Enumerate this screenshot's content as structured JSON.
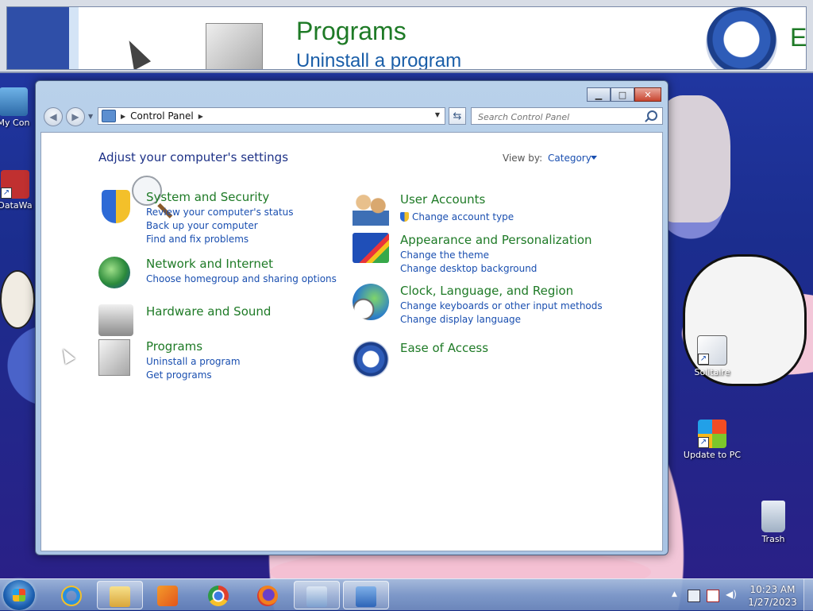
{
  "magnifier": {
    "title": "Programs",
    "subtitle": "Uninstall a program",
    "right_fragment": "E"
  },
  "desktop": {
    "icons": [
      {
        "name": "My Con",
        "icon": "computer-icon"
      },
      {
        "name": "DataWa",
        "icon": "app-shortcut-icon"
      },
      {
        "name": "Solitaire",
        "icon": "solitaire-icon"
      },
      {
        "name": "Update to PC",
        "icon": "windows-update-icon"
      },
      {
        "name": "Trash",
        "icon": "recycle-bin-icon"
      }
    ]
  },
  "window": {
    "controls": {
      "minimize": "▁",
      "maximize": "□",
      "close": "✕"
    },
    "address": {
      "root_label": "Control Panel"
    },
    "search": {
      "placeholder": "Search Control Panel"
    },
    "content_title": "Adjust your computer's settings",
    "view_by_label": "View by:",
    "view_by_value": "Category",
    "categories": [
      {
        "title": "System and Security",
        "icon": "shield-icon",
        "links": [
          "Review your computer's status",
          "Back up your computer",
          "Find and fix problems"
        ]
      },
      {
        "title": "Network and Internet",
        "icon": "network-globe-icon",
        "links": [
          "Choose homegroup and sharing options"
        ]
      },
      {
        "title": "Hardware and Sound",
        "icon": "printer-speaker-icon",
        "links": []
      },
      {
        "title": "Programs",
        "icon": "programs-icon",
        "links": [
          "Uninstall a program",
          "Get programs"
        ]
      },
      {
        "title": "User Accounts",
        "icon": "users-icon",
        "links": [
          "Change account type"
        ]
      },
      {
        "title": "Appearance and Personalization",
        "icon": "monitor-paint-icon",
        "links": [
          "Change the theme",
          "Change desktop background"
        ]
      },
      {
        "title": "Clock, Language, and Region",
        "icon": "clock-globe-icon",
        "links": [
          "Change keyboards or other input methods",
          "Change display language"
        ]
      },
      {
        "title": "Ease of Access",
        "icon": "ease-of-access-icon",
        "links": []
      }
    ]
  },
  "taskbar": {
    "apps": [
      "Internet Explorer",
      "Windows Explorer",
      "Media Player",
      "Google Chrome",
      "Firefox",
      "Magnifier",
      "Control Panel"
    ],
    "clock_time": "10:23 AM",
    "clock_date": "1/27/2023"
  },
  "colors": {
    "category_title": "#1e7a26",
    "link": "#1a4fb0",
    "heading": "#1e3287"
  }
}
